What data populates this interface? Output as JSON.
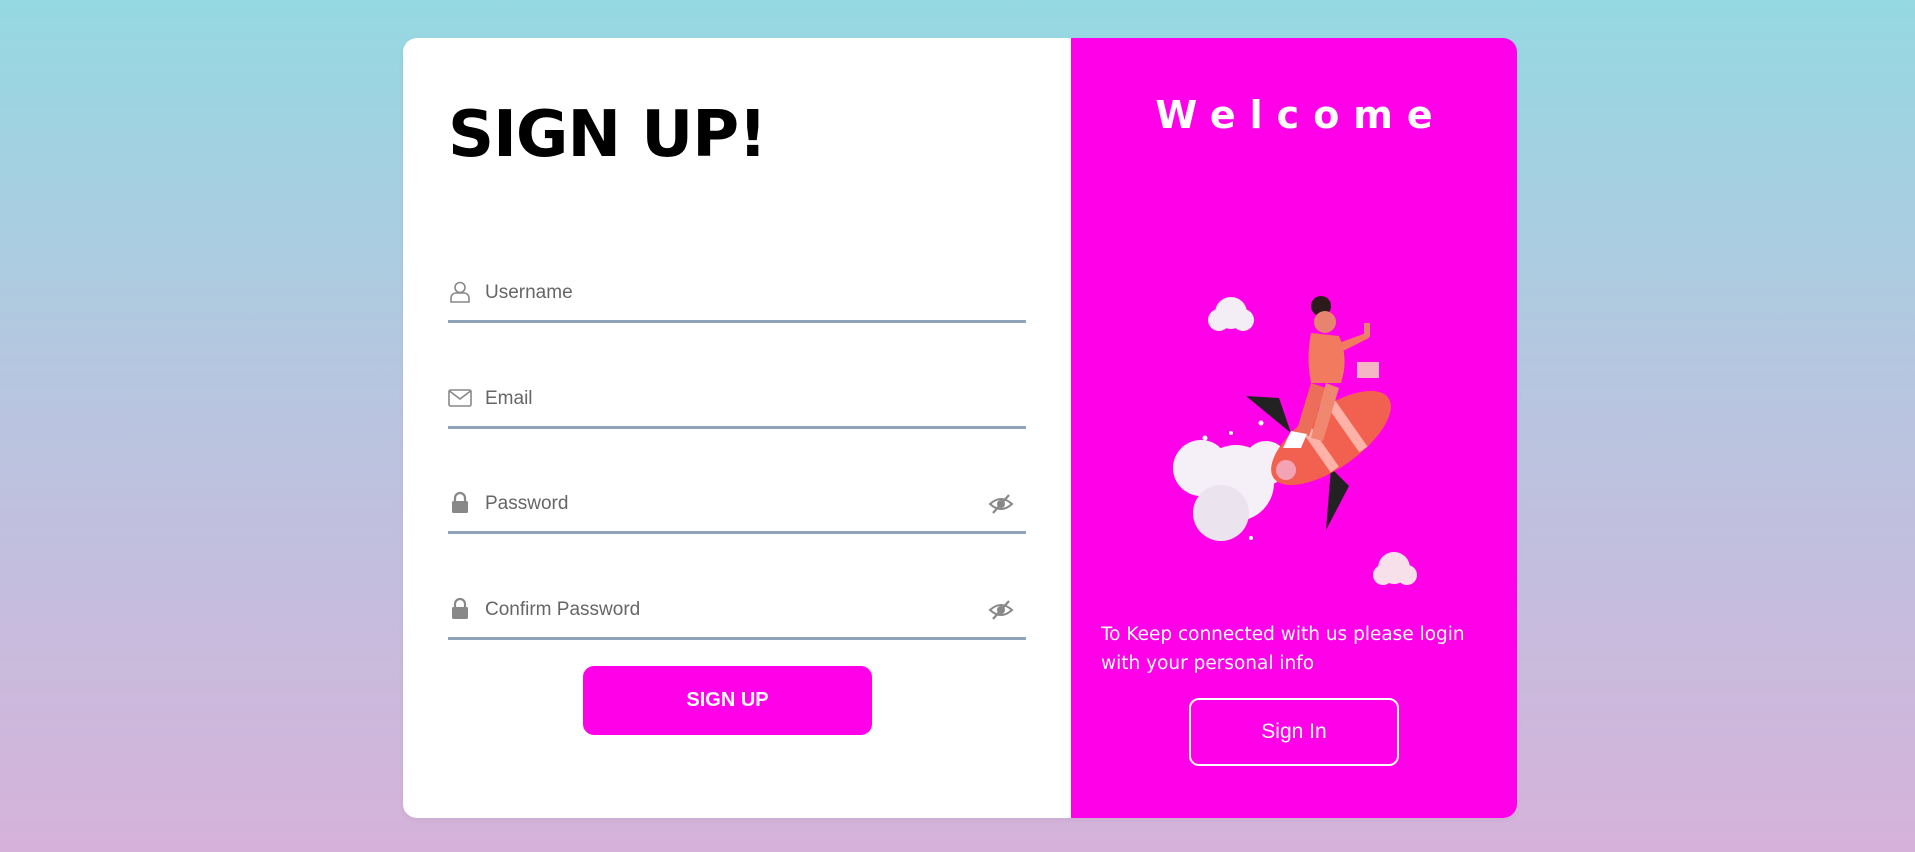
{
  "signup": {
    "title": "SIGN UP!",
    "fields": {
      "username": {
        "placeholder": "Username"
      },
      "email": {
        "placeholder": "Email"
      },
      "password": {
        "placeholder": "Password"
      },
      "confirm_password": {
        "placeholder": "Confirm Password"
      }
    },
    "button_label": "SIGN UP"
  },
  "welcome_panel": {
    "heading": "Welcome",
    "message": "To Keep connected with us please login with your personal info",
    "button_label": "Sign In",
    "illustration": "rocket-girl-illustration"
  },
  "colors": {
    "accent": "#ff00e8",
    "field_underline": "#8fa4b8",
    "background_top": "#95d9e2",
    "background_bottom": "#d6b2da"
  }
}
